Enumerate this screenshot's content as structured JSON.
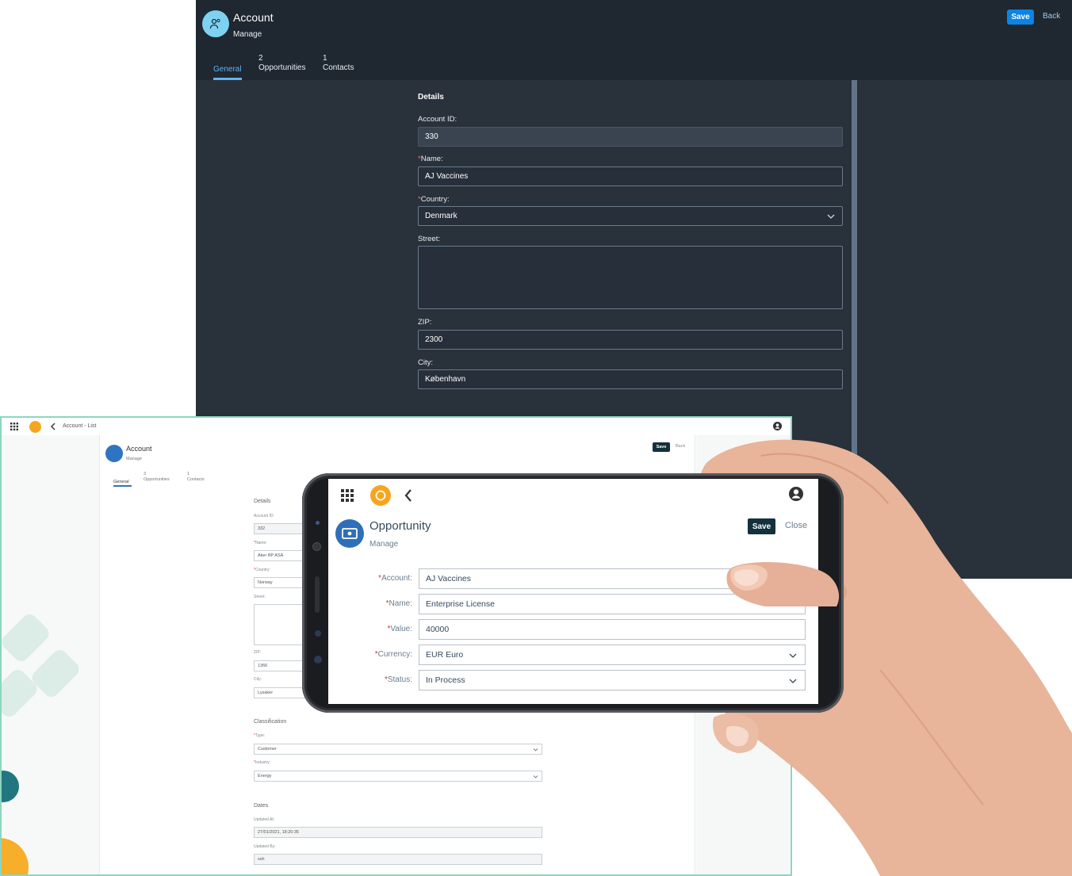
{
  "dark_app": {
    "title": "Account",
    "subtitle": "Manage",
    "save_label": "Save",
    "back_label": "Back",
    "tabs": [
      {
        "count": "",
        "label": "General"
      },
      {
        "count": "2",
        "label": "Opportunities"
      },
      {
        "count": "1",
        "label": "Contacts"
      }
    ],
    "section_title": "Details",
    "fields": {
      "account_id": {
        "label": "Account ID:",
        "value": "330"
      },
      "name": {
        "label": "Name:",
        "value": "AJ Vaccines"
      },
      "country": {
        "label": "Country:",
        "value": "Denmark"
      },
      "street": {
        "label": "Street:",
        "value": ""
      },
      "zip": {
        "label": "ZIP:",
        "value": "2300"
      },
      "city": {
        "label": "City:",
        "value": "København"
      }
    },
    "colors": {
      "accent": "#0a84e6",
      "background": "#29313a"
    }
  },
  "light_app": {
    "breadcrumb": "Account - List",
    "title": "Account",
    "subtitle": "Manage",
    "save_label": "Save",
    "back_label": "Back",
    "tabs": [
      {
        "count": "",
        "label": "General"
      },
      {
        "count": "3",
        "label": "Opportunities"
      },
      {
        "count": "1",
        "label": "Contacts"
      }
    ],
    "details_title": "Details",
    "fields": {
      "account_id": {
        "label": "Account ID:",
        "value": "332"
      },
      "name": {
        "label": "Name:",
        "value": "Aker BP ASA"
      },
      "country": {
        "label": "Country:",
        "value": "Norway"
      },
      "street": {
        "label": "Street:",
        "value": ""
      },
      "zip": {
        "label": "ZIP:",
        "value": "1366"
      },
      "city": {
        "label": "City:",
        "value": "Lysaker"
      }
    },
    "classification_title": "Classification",
    "classification": {
      "type": {
        "label": "Type:",
        "value": "Customer"
      },
      "industry": {
        "label": "Industry:",
        "value": "Energy"
      }
    },
    "dates_title": "Dates",
    "dates": {
      "updated_at": {
        "label": "Updated At:",
        "value": "27/01/2021, 18:20:35"
      },
      "updated_by": {
        "label": "Updated By:",
        "value": "ssh"
      }
    }
  },
  "mobile_app": {
    "title": "Opportunity",
    "subtitle": "Manage",
    "save_label": "Save",
    "close_label": "Close",
    "fields": {
      "account": {
        "label": "Account:",
        "value": "AJ Vaccines"
      },
      "name": {
        "label": "Name:",
        "value": "Enterprise License"
      },
      "value": {
        "label": "Value:",
        "value": "40000"
      },
      "currency": {
        "label": "Currency:",
        "value": "EUR Euro"
      },
      "status": {
        "label": "Status:",
        "value": "In Process"
      }
    },
    "colors": {
      "logo": "#f7a51e",
      "primary_button": "#12313d",
      "object_icon": "#2f6fb9"
    }
  },
  "icons": [
    "account-icon",
    "app-launcher-icon",
    "company-logo-icon",
    "back-icon",
    "user-icon",
    "opportunity-icon",
    "chevron-down-icon"
  ]
}
